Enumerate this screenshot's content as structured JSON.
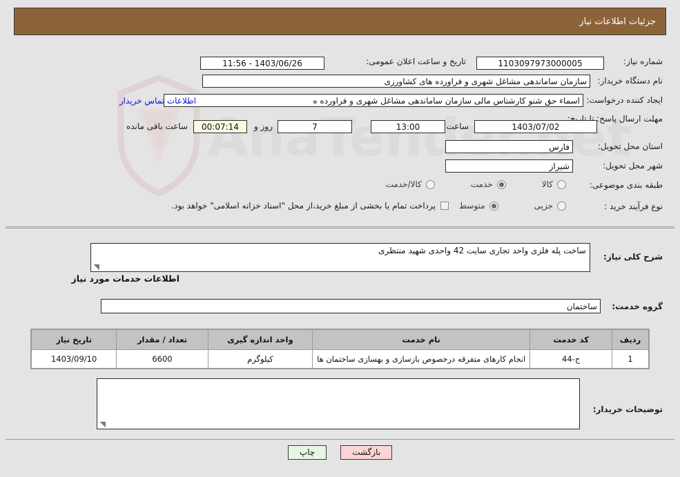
{
  "header": {
    "title": "جزئیات اطلاعات نیاز",
    "bar_color": "#8c6239"
  },
  "form": {
    "need_number_label": "شماره نیاز:",
    "need_number_value": "1103097973000005",
    "announce_datetime_label": "تاریخ و ساعت اعلان عمومی:",
    "announce_datetime_value": "1403/06/26 - 11:56",
    "buyer_org_label": "نام دستگاه خریدار:",
    "buyer_org_value": "سازمان ساماندهی مشاغل شهری و فراورده های کشاورزی",
    "requester_label": "ایجاد کننده درخواست:",
    "requester_value": "اسماء حق شنو کارشناس مالی  سازمان ساماندهی مشاغل شهری و فراورده ه",
    "contact_link": "اطلاعات تماس خریدار",
    "deadline_label": "مهلت ارسال پاسخ: تا تاریخ:",
    "deadline_date": "1403/07/02",
    "hour_label": "ساعت",
    "deadline_time": "13:00",
    "days_value": "7",
    "days_label": "روز و",
    "countdown_value": "00:07:14",
    "countdown_label": "ساعت باقی مانده",
    "province_label": "استان محل تحویل:",
    "province_value": "فارس",
    "city_label": "شهر محل تحویل:",
    "city_value": "شیراز",
    "category_label": "طبقه بندی موضوعی:",
    "category_options": [
      {
        "label": "کالا",
        "selected": false
      },
      {
        "label": "خدمت",
        "selected": true
      },
      {
        "label": "کالا/خدمت",
        "selected": false
      }
    ],
    "process_label": "نوع فرآیند خرید :",
    "process_options": [
      {
        "label": "جزیی",
        "selected": false
      },
      {
        "label": "متوسط",
        "selected": true
      }
    ],
    "treasury_note": "پرداخت تمام یا بخشی از مبلغ خرید،از محل \"اسناد خزانه اسلامی\" خواهد بود."
  },
  "description": {
    "label": "شرح کلی نیاز:",
    "value": "ساخت پله فلزی واحد تجاری سایت 42 واحدی شهید منتظری"
  },
  "services": {
    "section_title": "اطلاعات خدمات مورد نیاز",
    "group_label": "گروه خدمت:",
    "group_value": "ساختمان",
    "columns": [
      "ردیف",
      "کد خدمت",
      "نام خدمت",
      "واحد اندازه گیری",
      "تعداد / مقدار",
      "تاریخ نیاز"
    ],
    "rows": [
      {
        "index": "1",
        "code": "ج-44",
        "name": "انجام کارهای متفرقه درخصوص بازسازی و بهسازی ساختمان ها",
        "unit": "کیلوگرم",
        "quantity": "6600",
        "need_date": "1403/09/10"
      }
    ]
  },
  "comments": {
    "label": "توضیحات خریدار:",
    "value": ""
  },
  "footer": {
    "print_label": "چاپ",
    "back_label": "بازگشت"
  },
  "watermark": {
    "text": "AnaTender.net"
  }
}
